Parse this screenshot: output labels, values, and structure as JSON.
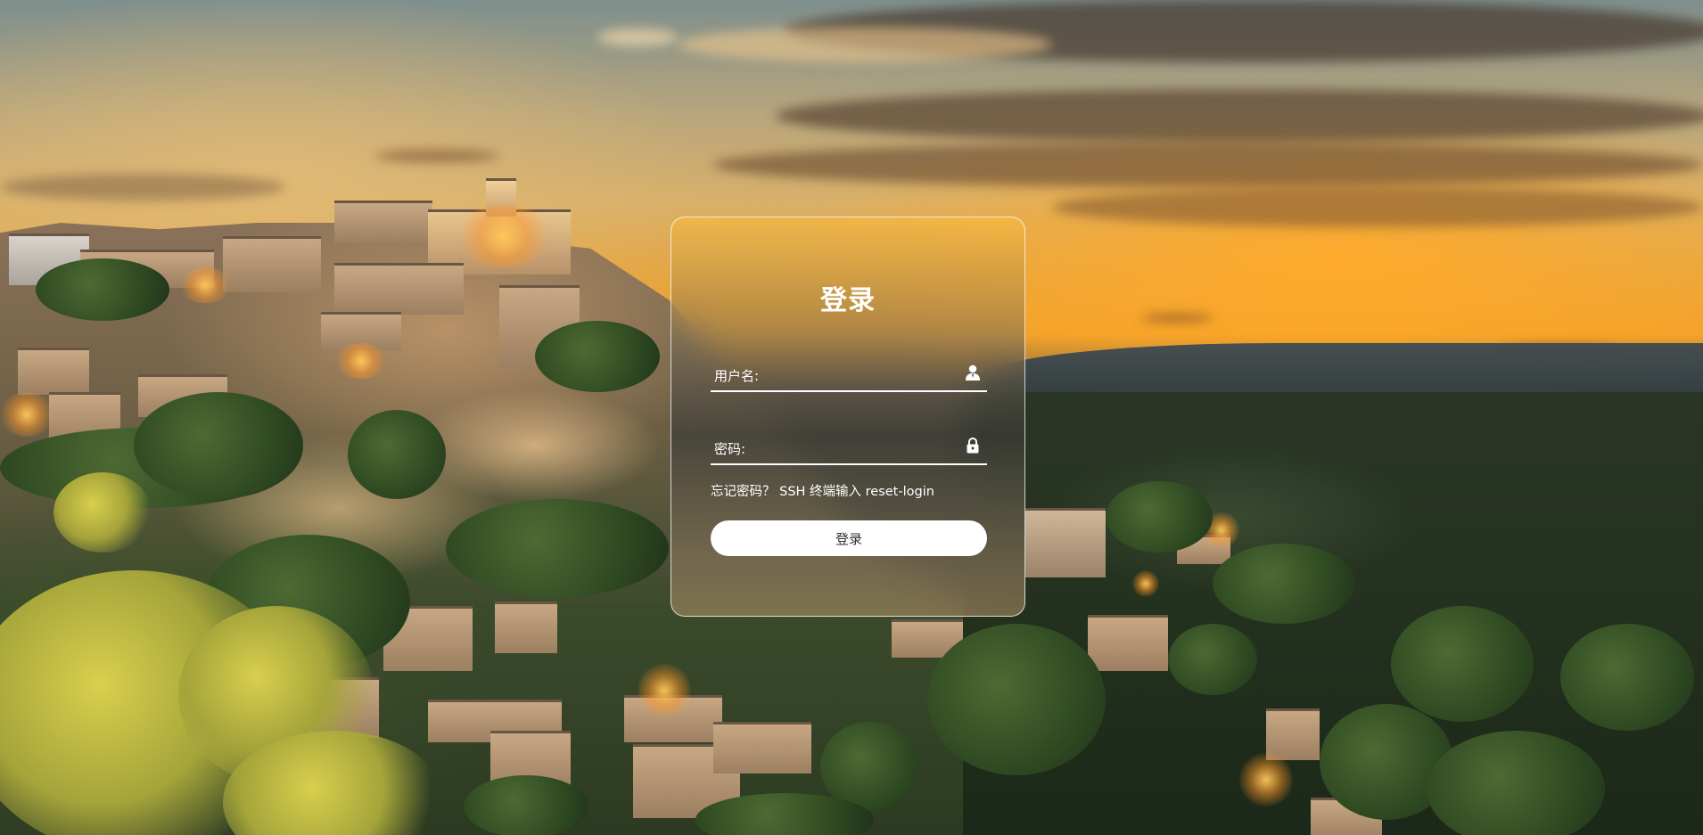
{
  "background": {
    "description_icon": "landscape-background"
  },
  "login": {
    "title": "登录",
    "username_label": "用户名:",
    "username_value": "",
    "password_label": "密码:",
    "password_value": "",
    "forgot_text": "忘记密码？ SSH 终端输入 reset-login",
    "submit_label": "登录",
    "user_icon": "user-icon",
    "lock_icon": "lock-icon"
  },
  "colors": {
    "card_border": "#ffffff",
    "button_bg": "#ffffff",
    "text": "#ffffff"
  }
}
